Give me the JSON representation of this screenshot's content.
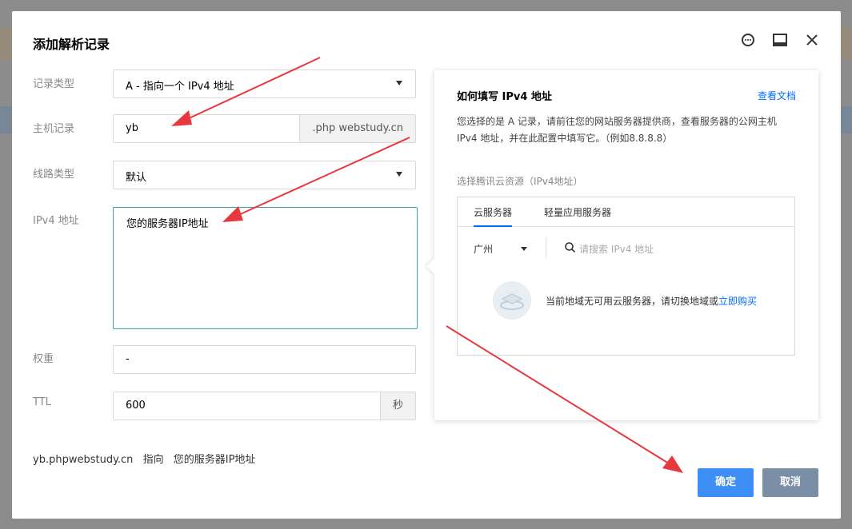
{
  "dialog": {
    "title": "添加解析记录",
    "header_icons": [
      "feedback-icon",
      "minimize-icon",
      "close-icon"
    ]
  },
  "form": {
    "record_type": {
      "label": "记录类型",
      "value": "A - 指向一个 IPv4 地址"
    },
    "host": {
      "label": "主机记录",
      "value": "yb",
      "suffix": ".php webstudy.cn"
    },
    "line": {
      "label": "线路类型",
      "value": "默认"
    },
    "ipv4": {
      "label": "IPv4 地址",
      "value": "您的服务器IP地址"
    },
    "weight": {
      "label": "权重",
      "value": "-"
    },
    "ttl": {
      "label": "TTL",
      "value": "600",
      "unit": "秒"
    }
  },
  "summary": {
    "domain": "yb.phpwebstudy.cn",
    "points_to": "指向",
    "target": "您的服务器IP地址"
  },
  "help_panel": {
    "title": "如何填写 IPv4 地址",
    "doc_link": "查看文档",
    "description": "您选择的是 A 记录，请前往您的网站服务器提供商，查看服务器的公网主机 IPv4 地址，并在此配置中填写它。（例如8.8.8.8）",
    "resource_label": "选择腾讯云资源（IPv4地址）",
    "tabs": [
      "云服务器",
      "轻量应用服务器"
    ],
    "region": "广州",
    "search_placeholder": "请搜索 IPv4 地址",
    "empty_text": "当前地域无可用云服务器，请切换地域或",
    "buy_link": "立即购买"
  },
  "buttons": {
    "ok": "确定",
    "cancel": "取消"
  },
  "colors": {
    "primary": "#3d8ff5",
    "cancel": "#7a8fa6",
    "link": "#006eff",
    "annotation_arrow": "#e8383d"
  }
}
